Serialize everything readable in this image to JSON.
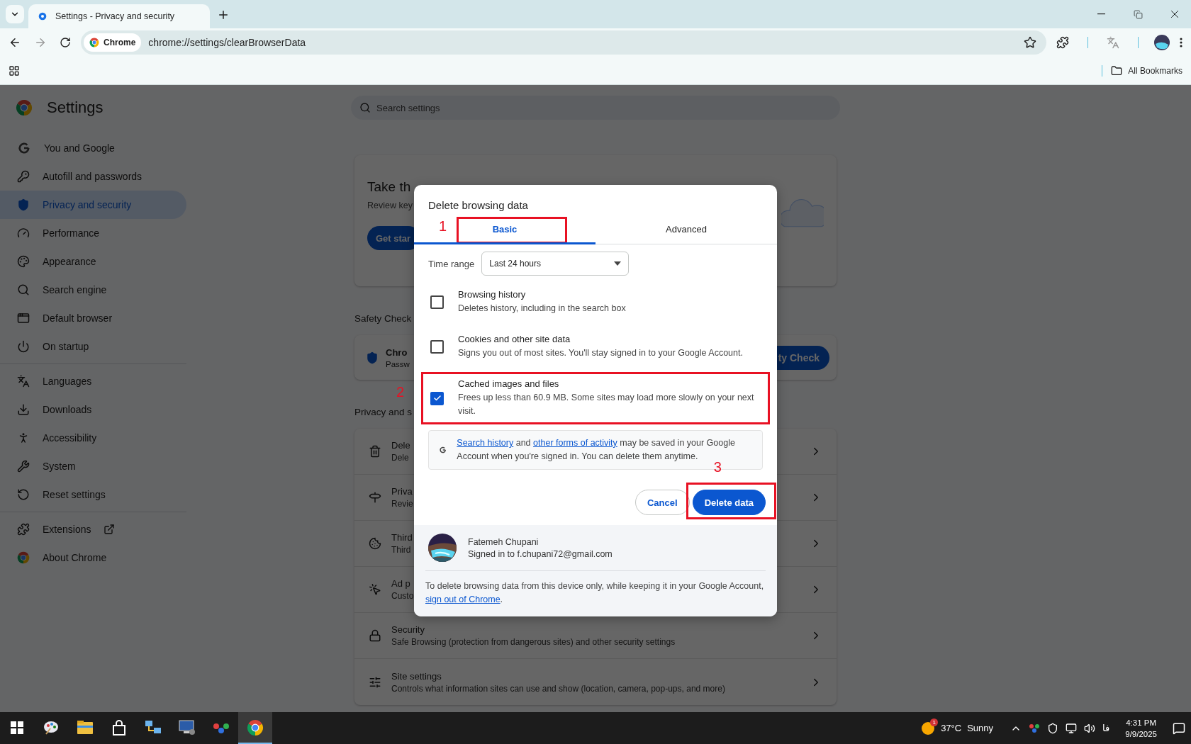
{
  "browser": {
    "tabs": [
      {
        "title": "Settings - Privacy and security",
        "selected": true
      }
    ],
    "omnibox": {
      "chip": "Chrome",
      "url": "chrome://settings/clearBrowserData"
    },
    "bookmarks": {
      "folder": "All Bookmarks"
    }
  },
  "settings": {
    "title": "Settings",
    "search": {
      "placeholder": "Search settings"
    },
    "nav_groups": [
      {
        "items": [
          {
            "label": "You and Google",
            "selected": false
          },
          {
            "label": "Autofill and passwords",
            "selected": false
          },
          {
            "label": "Privacy and security",
            "selected": true
          },
          {
            "label": "Performance",
            "selected": false
          },
          {
            "label": "Appearance",
            "selected": false
          },
          {
            "label": "Search engine",
            "selected": false
          },
          {
            "label": "Default browser",
            "selected": false
          },
          {
            "label": "On startup",
            "selected": false
          }
        ]
      },
      {
        "items": [
          {
            "label": "Languages",
            "selected": false
          },
          {
            "label": "Downloads",
            "selected": false
          },
          {
            "label": "Accessibility",
            "selected": false
          },
          {
            "label": "System",
            "selected": false
          },
          {
            "label": "Reset settings",
            "selected": false
          }
        ]
      },
      {
        "items": [
          {
            "label": "Extensions",
            "selected": false,
            "external": true
          },
          {
            "label": "About Chrome",
            "selected": false
          }
        ]
      }
    ],
    "hero": {
      "title": "Take th",
      "text": "Review key",
      "button": "Get star"
    },
    "safety_check": {
      "heading": "Safety Check",
      "title": "Chro",
      "text": "Passw",
      "button": "ty Check"
    },
    "privacy": {
      "heading": "Privacy and s",
      "rows": [
        {
          "title": "Dele",
          "text": "Dele"
        },
        {
          "title": "Priva",
          "text": "Revie"
        },
        {
          "title": "Third",
          "text": "Third"
        },
        {
          "title": "Ad p",
          "text": "Custo"
        },
        {
          "title": "Security",
          "text": "Safe Browsing (protection from dangerous sites) and other security settings"
        },
        {
          "title": "Site settings",
          "text": "Controls what information sites can use and show (location, camera, pop-ups, and more)"
        }
      ]
    }
  },
  "dialog": {
    "title": "Delete browsing data",
    "tabs": [
      {
        "label": "Basic",
        "selected": true,
        "annotation": "1"
      },
      {
        "label": "Advanced",
        "selected": false
      }
    ],
    "time_range": {
      "label": "Time range",
      "value": "Last 24 hours"
    },
    "options": [
      {
        "title": "Browsing history",
        "text": "Deletes history, including in the search box",
        "checked": false
      },
      {
        "title": "Cookies and other site data",
        "text": "Signs you out of most sites. You'll stay signed in to your Google Account.",
        "checked": false
      },
      {
        "title": "Cached images and files",
        "text": "Frees up less than 60.9 MB. Some sites may load more slowly on your next visit.",
        "checked": true,
        "annotation": "2"
      }
    ],
    "info": [
      {
        "text": "Search history",
        "link": true
      },
      {
        "text": " and ",
        "link": false
      },
      {
        "text": "other forms of activity",
        "link": true
      },
      {
        "text": " may be saved in your Google Account when you're signed in. You can delete them anytime.",
        "link": false
      }
    ],
    "buttons": [
      {
        "label": "Cancel",
        "kind": "outline"
      },
      {
        "label": "Delete data",
        "kind": "primary",
        "annotation": "3"
      }
    ],
    "account": {
      "name": "Fatemeh Chupani",
      "email": "Signed in to f.chupani72@gmail.com"
    },
    "footer": [
      {
        "text": "To delete browsing data from this device only, while keeping it in your Google Account, ",
        "link": false
      },
      {
        "text": "sign out of Chrome",
        "link": true
      },
      {
        "text": ".",
        "link": false
      }
    ]
  },
  "taskbar": {
    "apps": [
      {
        "selected": false
      },
      {
        "selected": false
      },
      {
        "selected": false
      },
      {
        "selected": false
      },
      {
        "selected": false
      },
      {
        "selected": false
      },
      {
        "selected": true
      }
    ],
    "weather": {
      "badge": "1",
      "temp": "37°C",
      "condition": "Sunny"
    },
    "language": "فا",
    "time": "4:31 PM",
    "date": "9/9/2025"
  }
}
